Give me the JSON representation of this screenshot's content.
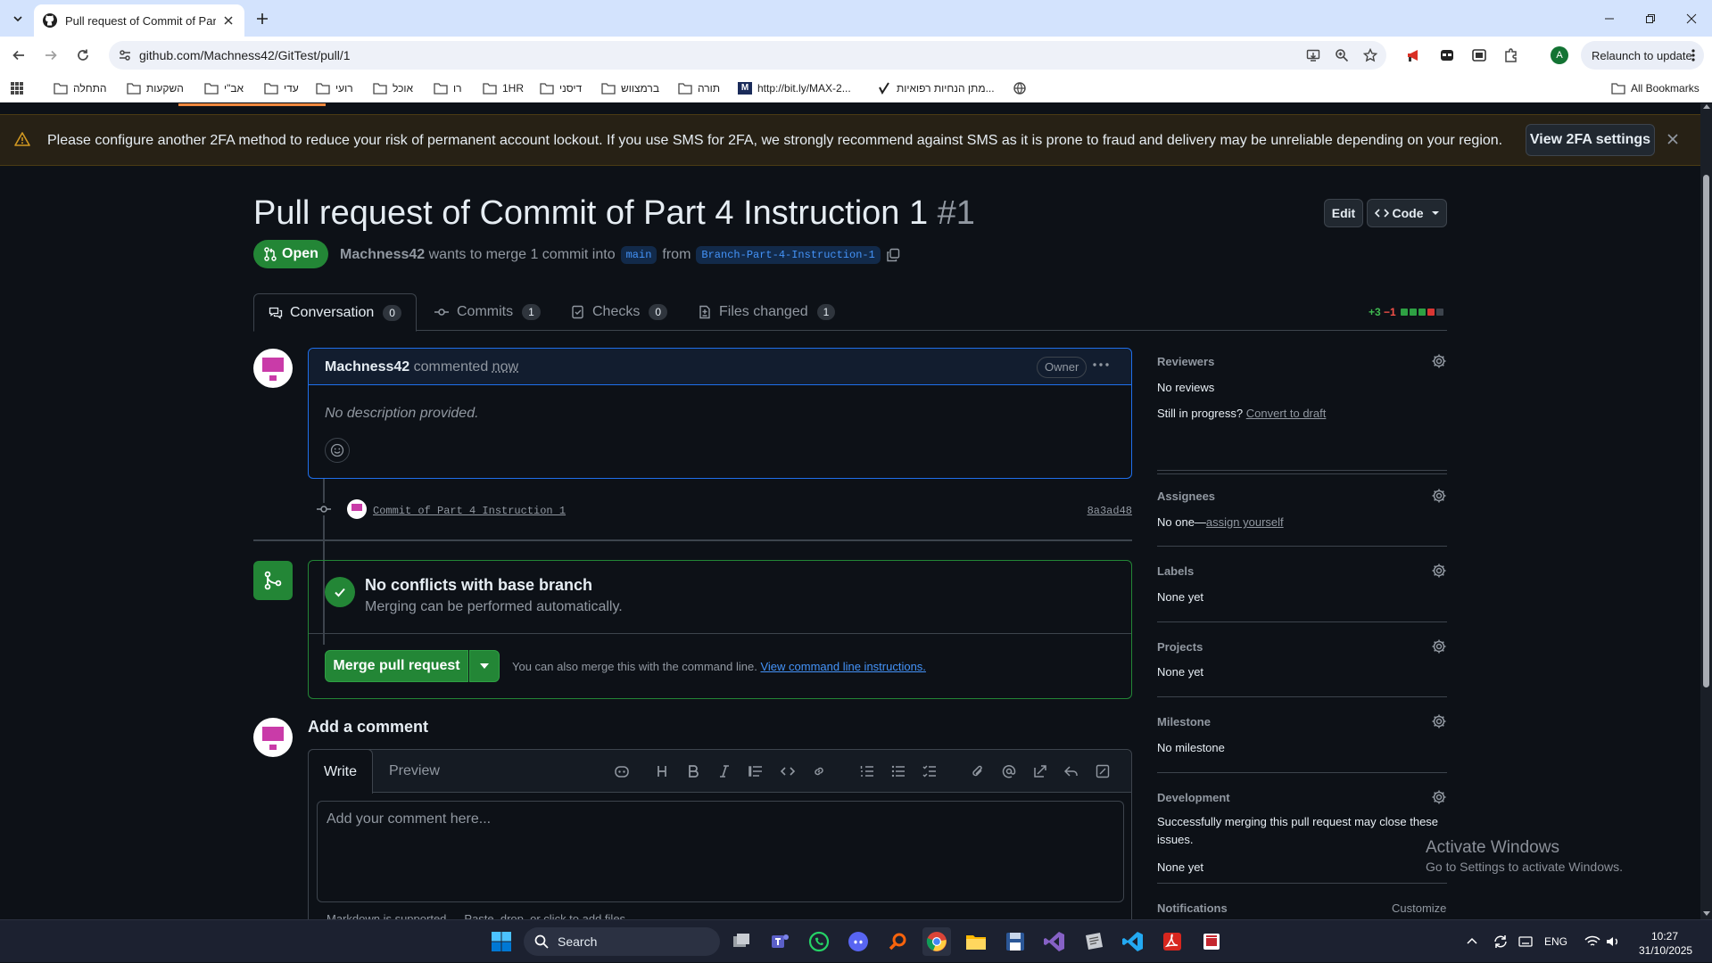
{
  "browser": {
    "tab_title": "Pull request of Commit of Part",
    "url": "github.com/Machness42/GitTest/pull/1",
    "relaunch_label": "Relaunch to update",
    "profile_initial": "A",
    "bookmarks": [
      "התחלה",
      "השקעות",
      "אב\"י",
      "עדי",
      "רועי",
      "אוכל",
      "רו",
      "1HR",
      "דיסני",
      "ברמצווש",
      "תורה",
      "http://bit.ly/MAX-2...",
      "מתן הנחיות רפואיות...",
      ""
    ],
    "all_bookmarks": "All Bookmarks"
  },
  "banner": {
    "message": "Please configure another 2FA method to reduce your risk of permanent account lockout. If you use SMS for 2FA, we strongly recommend against SMS as it is prone to fraud and delivery may be unreliable depending on your region.",
    "button": "View 2FA settings"
  },
  "pr": {
    "title": "Pull request of Commit of Part 4 Instruction 1",
    "number": "#1",
    "edit_label": "Edit",
    "code_label": "Code",
    "state": "Open",
    "author": "Machness42",
    "merge_text_1": "wants to merge 1 commit into",
    "base_branch": "main",
    "merge_text_2": "from",
    "head_branch": "Branch-Part-4-Instruction-1"
  },
  "tabs": [
    {
      "label": "Conversation",
      "count": "0"
    },
    {
      "label": "Commits",
      "count": "1"
    },
    {
      "label": "Checks",
      "count": "0"
    },
    {
      "label": "Files changed",
      "count": "1"
    }
  ],
  "diffstat": {
    "added": "+3",
    "removed": "−1",
    "colors": [
      "#2ea043",
      "#2ea043",
      "#2ea043",
      "#da3633",
      "#3d444d"
    ]
  },
  "comment": {
    "author": "Machness42",
    "action": "commented",
    "time": "now",
    "badge": "Owner",
    "body": "No description provided."
  },
  "commit": {
    "message": "Commit of Part 4 Instruction 1",
    "sha": "8a3ad48"
  },
  "merge": {
    "heading": "No conflicts with base branch",
    "subtext": "Merging can be performed automatically.",
    "button": "Merge pull request",
    "alt_text": "You can also merge this with the command line.",
    "alt_link": "View command line instructions."
  },
  "add_comment": {
    "title": "Add a comment",
    "write_tab": "Write",
    "preview_tab": "Preview",
    "placeholder": "Add your comment here...",
    "markdown_note": "Markdown is supported",
    "paste_note": "Paste, drop, or click to add files"
  },
  "sidebar": {
    "reviewers": {
      "heading": "Reviewers",
      "value": "No reviews",
      "progress_text": "Still in progress?",
      "progress_link": "Convert to draft"
    },
    "assignees": {
      "heading": "Assignees",
      "value": "No one—",
      "link": "assign yourself"
    },
    "labels": {
      "heading": "Labels",
      "value": "None yet"
    },
    "projects": {
      "heading": "Projects",
      "value": "None yet"
    },
    "milestone": {
      "heading": "Milestone",
      "value": "No milestone"
    },
    "development": {
      "heading": "Development",
      "text_1": "Successfully merging this pull request may close these",
      "text_2": "issues.",
      "value": "None yet"
    },
    "notifications": {
      "heading": "Notifications",
      "customize": "Customize"
    }
  },
  "watermark": {
    "line1": "Activate Windows",
    "line2": "Go to Settings to activate Windows."
  },
  "taskbar": {
    "search": "Search",
    "lang": "ENG",
    "time": "10:27",
    "date": "31/10/2025"
  }
}
